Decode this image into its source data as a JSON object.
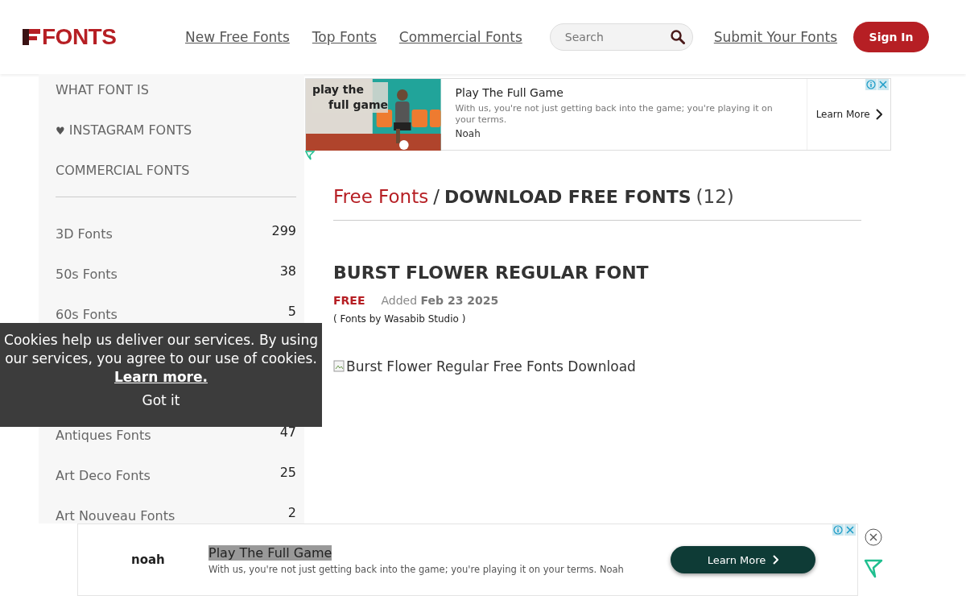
{
  "header": {
    "logo": "FONTS",
    "nav": [
      "New Free Fonts",
      "Top Fonts",
      "Commercial Fonts"
    ],
    "search": {
      "placeholder": "Search"
    },
    "submit_link": "Submit Your Fonts",
    "sign_in": "Sign In"
  },
  "sidebar": {
    "top_links": [
      {
        "label": "WHAT FONT IS"
      },
      {
        "icon": "♥",
        "label": "INSTAGRAM FONTS"
      },
      {
        "label": "COMMERCIAL FONTS"
      }
    ],
    "categories": [
      {
        "label": "3D Fonts",
        "count": "299"
      },
      {
        "label": "50s Fonts",
        "count": "38"
      },
      {
        "label": "60s Fonts",
        "count": "5"
      },
      {
        "label": "Antiques Fonts",
        "count": "47"
      },
      {
        "label": "Art Deco Fonts",
        "count": "25"
      },
      {
        "label": "Art Nouveau Fonts",
        "count": "2"
      }
    ]
  },
  "top_ad": {
    "image_text": [
      "play the",
      "full game"
    ],
    "title": "Play The Full Game",
    "text": "With us, you're not just getting back into the game; you're playing it on your terms.",
    "advertiser": "Noah",
    "cta": "Learn More"
  },
  "breadcrumb": {
    "link": "Free Fonts",
    "separator": "/",
    "current": "DOWNLOAD FREE FONTS",
    "count": "(12)"
  },
  "font": {
    "title": "BURST FLOWER REGULAR FONT",
    "badge": "FREE",
    "added_label": "Added",
    "added_date": "Feb 23 2025",
    "author": "( Fonts by Wasabib Studio )",
    "image_alt": "Burst Flower Regular Free Fonts Download"
  },
  "cookie_banner": {
    "text": "Cookies help us deliver our services. By using our services, you agree to our use of cookies.",
    "link": "Learn more.",
    "button": "Got it"
  },
  "bottom_ad": {
    "brand": "noah",
    "title": "Play The Full Game",
    "text": "With us, you're not just getting back into the game; you're playing it on your terms. Noah",
    "cta": "Learn More"
  }
}
